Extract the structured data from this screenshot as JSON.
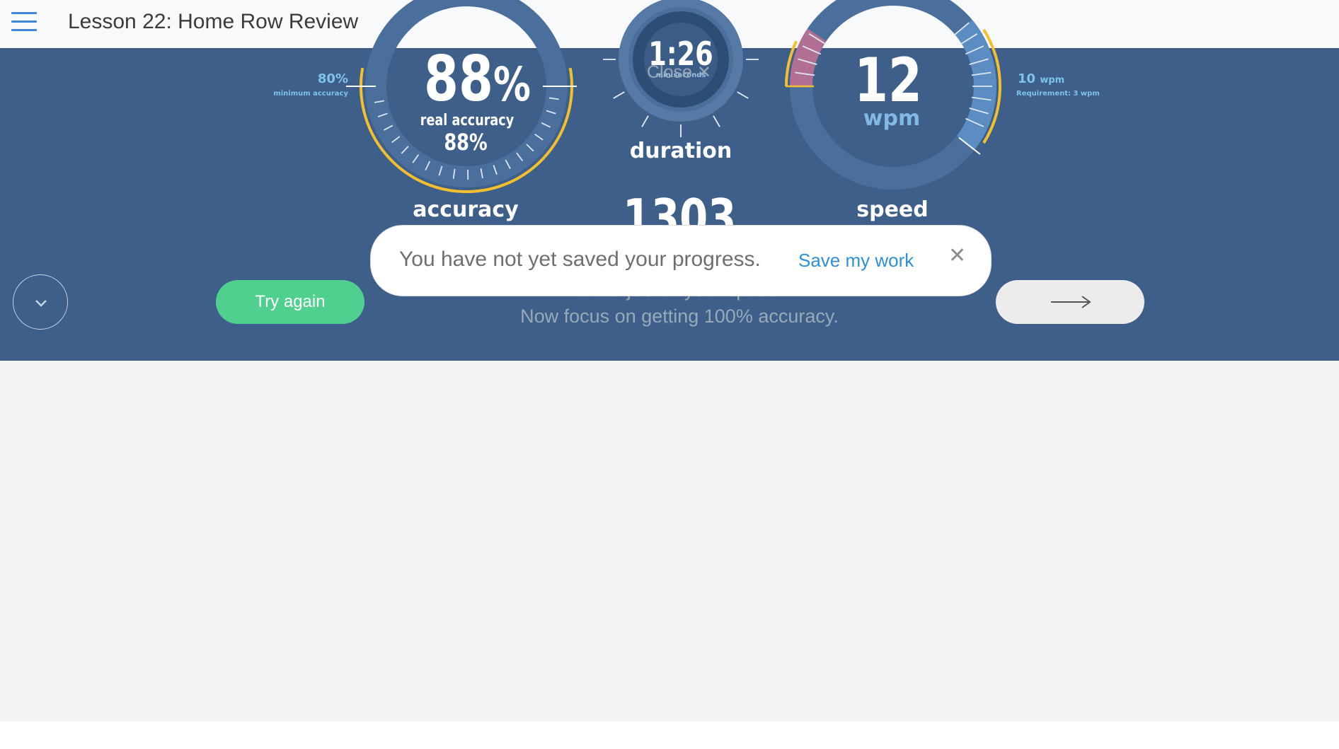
{
  "header": {
    "menu_icon": "hamburger-menu-icon",
    "title": "Lesson 22: Home Row Review"
  },
  "colors": {
    "header_bg": "#f8f9fa",
    "results_bg": "#3d5f89",
    "gauge_ring": "#4a6f9c",
    "accuracy_gold": "#f3bf2f",
    "speed_pink": "#b06f93",
    "light_text": "#7ec3ea",
    "try_again": "#4fd08f",
    "link_blue": "#2f8fd8",
    "page_gray": "#f3f3f3"
  },
  "accuracy": {
    "value": "88",
    "unit": "%",
    "real_label": "real accuracy",
    "real_value": "88%",
    "label": "accuracy",
    "minimum_value": "80%",
    "minimum_label": "minimum accuracy",
    "fill_fraction": 0.88
  },
  "duration": {
    "value": "1:26",
    "sub_label": "min:seconds",
    "label": "duration",
    "close_text": "Close",
    "close_icon": "close-x-icon",
    "keystrokes": "1303"
  },
  "speed": {
    "value": "12",
    "unit": "wpm",
    "label": "speed",
    "target_value": "10",
    "target_unit": "wpm",
    "requirement": "Requirement: 3 wpm"
  },
  "feedback": {
    "line1": "Good job on your speed!",
    "line2": "Now focus on getting 100% accuracy."
  },
  "toast": {
    "message": "You have not yet saved your progress.",
    "link": "Save my work",
    "close_icon": "close-x-icon"
  },
  "buttons": {
    "expand_icon": "chevron-down-icon",
    "try_again": "Try again",
    "next_icon": "arrow-right-icon"
  }
}
